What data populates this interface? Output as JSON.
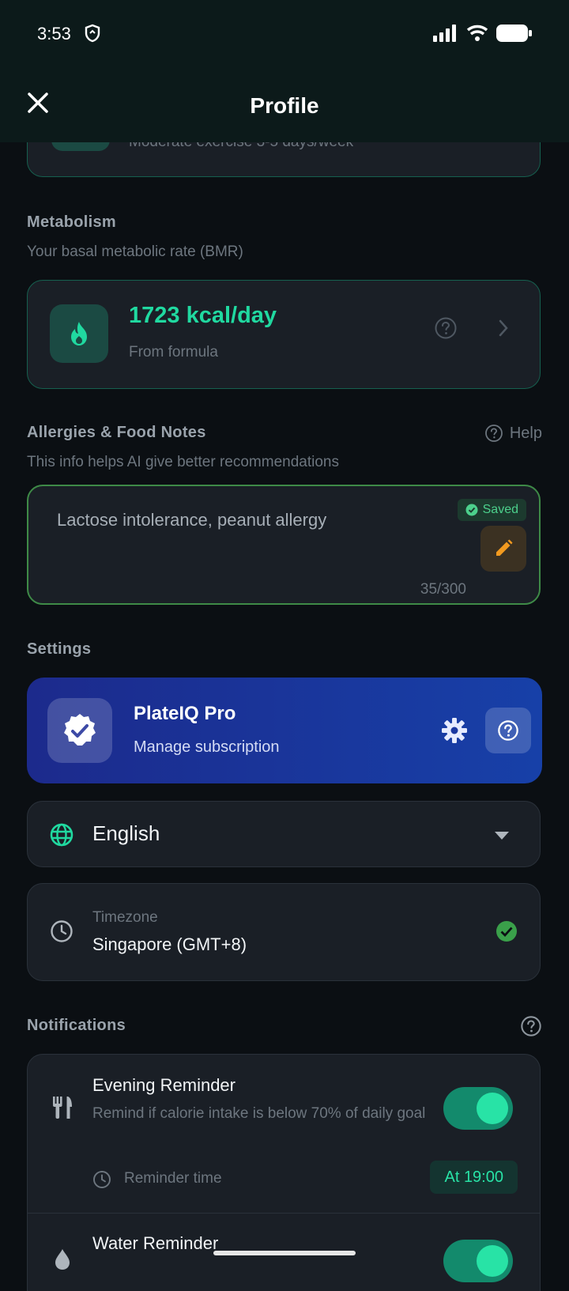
{
  "status": {
    "time": "3:53"
  },
  "header": {
    "title": "Profile"
  },
  "activity": {
    "subtitle_partial": "Moderate exercise 3-5 days/week"
  },
  "metabolism": {
    "title": "Metabolism",
    "subtitle": "Your basal metabolic rate (BMR)",
    "value": "1723 kcal/day",
    "source": "From formula"
  },
  "allergies": {
    "title": "Allergies & Food Notes",
    "help": "Help",
    "subtitle": "This info helps AI give better recommendations",
    "text": "Lactose intolerance, peanut allergy",
    "saved": "Saved",
    "counter": "35/300"
  },
  "settings": {
    "title": "Settings",
    "pro": {
      "title": "PlateIQ Pro",
      "subtitle": "Manage subscription"
    },
    "language": "English",
    "timezone": {
      "label": "Timezone",
      "value": "Singapore (GMT+8)"
    }
  },
  "notifications": {
    "title": "Notifications",
    "evening": {
      "title": "Evening Reminder",
      "desc": "Remind if calorie intake is below 70% of daily goal",
      "enabled": true,
      "time_label": "Reminder time",
      "time_value": "At 19:00"
    },
    "water": {
      "title": "Water Reminder",
      "enabled": true
    }
  },
  "colors": {
    "accent": "#20d9a0",
    "background": "#0b0f13",
    "card": "#1a1f26",
    "pro_gradient_start": "#1c2a8c",
    "pro_gradient_end": "#1740a8"
  }
}
